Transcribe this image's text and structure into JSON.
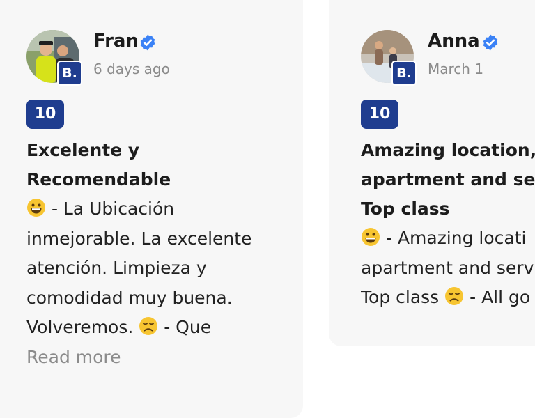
{
  "reviews": [
    {
      "author": "Fran",
      "date": "6 days ago",
      "platform_badge": "B.",
      "rating": "10",
      "title": "Excelente y Recomendable",
      "title_lines": [
        "Excelente y",
        "Recomendable"
      ],
      "body_lines": [
        {
          "emoji": "grinning-face-icon",
          "text": " - La Ubicación"
        },
        {
          "emoji": "",
          "text": "inmejorable. La excelente"
        },
        {
          "emoji": "",
          "text": "atención. Limpieza y"
        },
        {
          "emoji": "",
          "text": "comodidad muy buena."
        },
        {
          "emoji": "",
          "text": "Volveremos. ",
          "trail_emoji": "disappointed-face-icon",
          "trail_text": " - Que"
        }
      ],
      "read_more": "Read more"
    },
    {
      "author": "Anna",
      "date": "March 1",
      "platform_badge": "B.",
      "rating": "10",
      "title_lines": [
        "Amazing location,",
        "apartment and ser",
        "Top class"
      ],
      "body_lines": [
        {
          "emoji": "grinning-face-icon",
          "text": " - Amazing locati"
        },
        {
          "emoji": "",
          "text": "apartment and serv"
        },
        {
          "emoji": "",
          "text": "Top class ",
          "trail_emoji": "disappointed-face-icon",
          "trail_text": " - All go"
        }
      ]
    }
  ],
  "colors": {
    "card_bg": "#f7f7f7",
    "badge_blue": "#1f3d8f",
    "verified_blue": "#3b82f6",
    "muted_text": "#8b8b8b"
  }
}
